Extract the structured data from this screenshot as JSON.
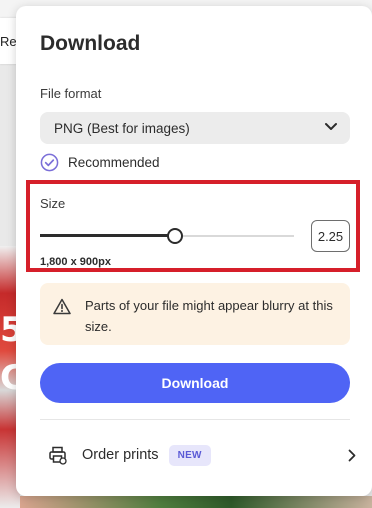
{
  "background": {
    "card_text": "Re",
    "image_glyphs": [
      "5",
      "C"
    ]
  },
  "panel": {
    "title": "Download",
    "file_format": {
      "label": "File format",
      "selected": "PNG (Best for images)",
      "icon": "chevron-down-icon"
    },
    "recommended": {
      "label": "Recommended",
      "icon": "check-circle-icon"
    },
    "size": {
      "label": "Size",
      "value": "2.25",
      "slider_fraction": 0.53,
      "dimensions": "1,800 x 900px",
      "highlight_color": "#d61f2a"
    },
    "warning": {
      "icon": "warning-icon",
      "text": "Parts of your file might appear blurry at this size."
    },
    "download_button": "Download",
    "order_prints": {
      "label": "Order prints",
      "badge": "NEW",
      "icon": "printer-icon",
      "arrow": "chevron-right-icon"
    }
  },
  "colors": {
    "primary": "#4f64f5",
    "recommended": "#7b6fd8",
    "warning_bg": "#fdf2e3",
    "badge_bg": "#e7e6fb",
    "badge_text": "#5b5bd6"
  }
}
